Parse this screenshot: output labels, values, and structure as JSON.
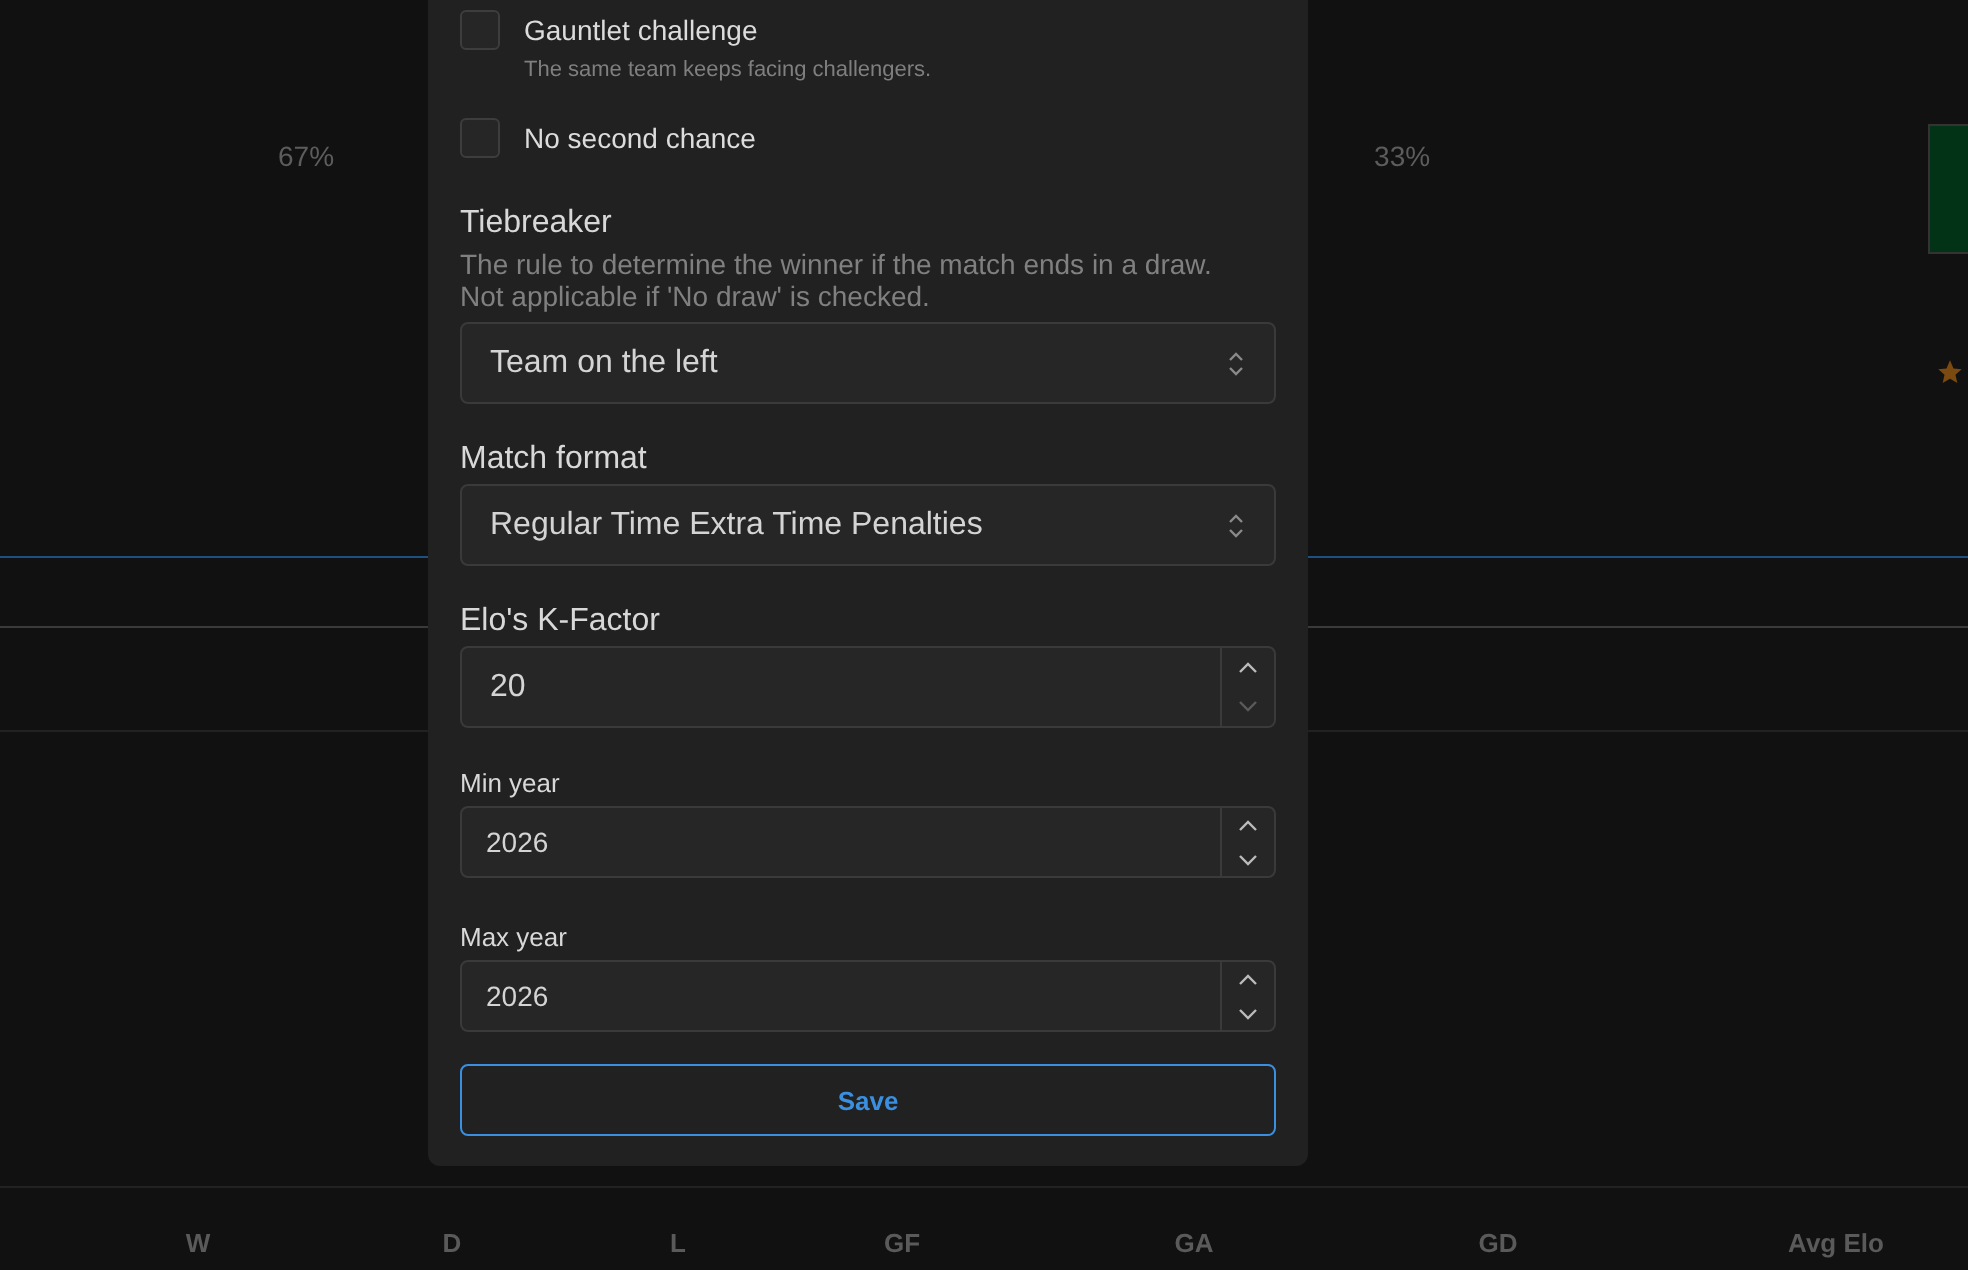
{
  "background": {
    "percentages": [
      "67%",
      "33%"
    ],
    "table_columns": [
      "W",
      "D",
      "L",
      "GF",
      "GA",
      "GD",
      "Avg Elo"
    ]
  },
  "modal": {
    "options": [
      {
        "label": "Gauntlet challenge",
        "description": "The same team keeps facing challengers.",
        "checked": false
      },
      {
        "label": "No second chance",
        "checked": false
      }
    ],
    "fields": [
      {
        "kind": "select",
        "label": "Tiebreaker",
        "description": [
          "The rule to determine the winner if the match ends in a draw.",
          "Not applicable if 'No draw' is checked."
        ],
        "value": "Team on the left"
      },
      {
        "kind": "select",
        "label": "Match format",
        "value": "Regular Time Extra Time Penalties"
      },
      {
        "kind": "number",
        "label": "Elo's K-Factor",
        "value": "20"
      },
      {
        "kind": "small-number",
        "label": "Min year",
        "value": "2026"
      },
      {
        "kind": "small-number",
        "label": "Max year",
        "value": "2026"
      }
    ],
    "save_button": "Save"
  }
}
